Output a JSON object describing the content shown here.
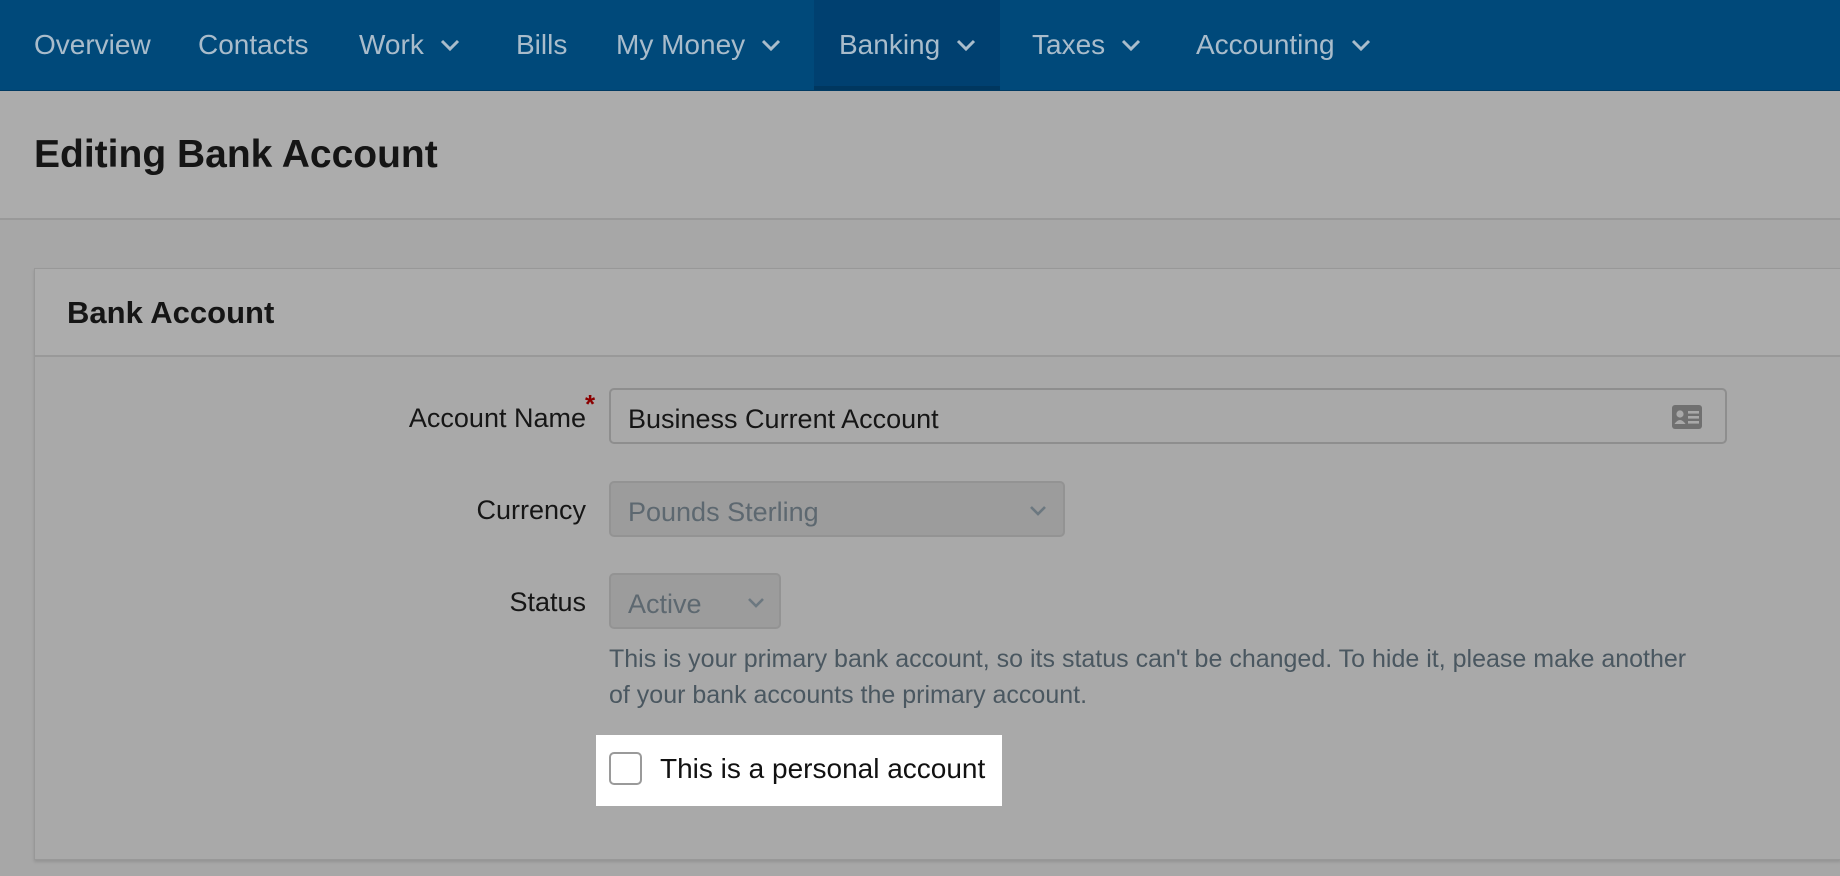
{
  "nav": {
    "items": [
      {
        "label": "Overview",
        "has_dropdown": false,
        "active": false
      },
      {
        "label": "Contacts",
        "has_dropdown": false,
        "active": false
      },
      {
        "label": "Work",
        "has_dropdown": true,
        "active": false
      },
      {
        "label": "Bills",
        "has_dropdown": false,
        "active": false
      },
      {
        "label": "My Money",
        "has_dropdown": true,
        "active": false
      },
      {
        "label": "Banking",
        "has_dropdown": true,
        "active": true
      },
      {
        "label": "Taxes",
        "has_dropdown": true,
        "active": false
      },
      {
        "label": "Accounting",
        "has_dropdown": true,
        "active": false
      }
    ]
  },
  "page": {
    "title": "Editing Bank Account"
  },
  "panel": {
    "title": "Bank Account",
    "fields": {
      "account_name": {
        "label": "Account Name",
        "required_marker": "*",
        "value": "Business Current Account",
        "icon": "contact-card-icon"
      },
      "currency": {
        "label": "Currency",
        "value": "Pounds Sterling",
        "disabled": true
      },
      "status": {
        "label": "Status",
        "value": "Active",
        "disabled": true,
        "help": "This is your primary bank account, so its status can't be changed. To hide it, please make another of your bank accounts the primary account."
      },
      "personal": {
        "label": "This is a personal account",
        "checked": false
      }
    }
  },
  "colors": {
    "nav_bg": "#00497a",
    "nav_text": "#a9bccb",
    "required": "#8b0000",
    "overlay_bg": "#a9a9a9"
  }
}
